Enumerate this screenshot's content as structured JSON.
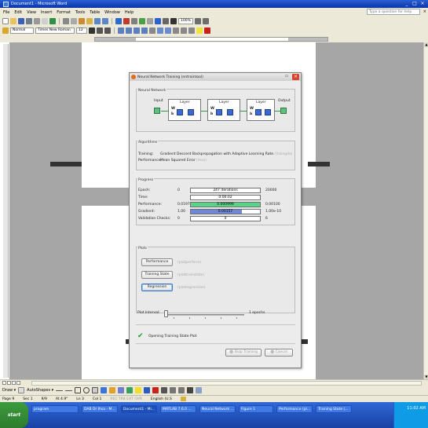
{
  "window": {
    "title": "Document1 - Microsoft Word",
    "controls": [
      "_",
      "□",
      "×"
    ]
  },
  "menu": {
    "items": [
      "File",
      "Edit",
      "View",
      "Insert",
      "Format",
      "Tools",
      "Table",
      "Window",
      "Help"
    ],
    "help_placeholder": "Type a question for help"
  },
  "formatting": {
    "style": "Normal",
    "font": "Times New Roman",
    "size": "12",
    "zoom": "100%"
  },
  "nn_dialog": {
    "title": "Neural Network Training (nntraintool)",
    "network_section": "Neural Network",
    "network": {
      "input_label": "Input",
      "layer_label": "Layer",
      "output_label": "Output",
      "w": "W",
      "b": "b"
    },
    "algorithms_section": "Algorithms",
    "training_label": "Training:",
    "training_value": "Gradient Descent Backpropagation with Adaptive Learning Rate.",
    "training_fn": "(traingdx)",
    "performance_label": "Performance:",
    "performance_value": "Mean Squared Error",
    "performance_fn": "(mse)",
    "progress_section": "Progress",
    "progress": [
      {
        "label": "Epoch:",
        "left": "0",
        "bar_text": "247 iterations",
        "right": "20000",
        "fill": 0,
        "color": ""
      },
      {
        "label": "Time:",
        "left": "",
        "bar_text": "0:00:02",
        "right": "",
        "fill": 0,
        "color": ""
      },
      {
        "label": "Performance:",
        "left": "0.0197",
        "bar_text": "0.000999",
        "right": "0.00100",
        "fill": 1.0,
        "color": "#59d487"
      },
      {
        "label": "Gradient:",
        "left": "1.00",
        "bar_text": "0.00157",
        "right": "1.00e-10",
        "fill": 0.74,
        "color": "#6f86d9"
      },
      {
        "label": "Validation Checks:",
        "left": "0",
        "bar_text": "0",
        "right": "6",
        "fill": 0,
        "color": ""
      }
    ],
    "plots_section": "Plots",
    "plots": [
      {
        "button": "Performance",
        "fn": "(plotperform)"
      },
      {
        "button": "Training State",
        "fn": "(plottrainstate)"
      },
      {
        "button": "Regression",
        "fn": "(plotregression)"
      }
    ],
    "plot_interval_label": "Plot Interval:",
    "plot_interval_value": "1 epochs",
    "status_text": "Opening Training State Plot",
    "stop_button": "Stop Training",
    "cancel_button": "Cancel"
  },
  "drawbar": {
    "draw": "Draw ▾",
    "autoshapes": "AutoShapes ▾"
  },
  "status": {
    "page": "Page 9",
    "sec": "Sec 1",
    "pos": "9/9",
    "at": "At 4.9\"",
    "ln": "Ln 3",
    "col": "Col 1",
    "modes": "REC  TRK  EXT  OVR",
    "lang": "English (U.S"
  },
  "taskbar": {
    "start": "start",
    "tasks": [
      "program",
      "DAB Dr Ihsa - M...",
      "Document1 - Mi...",
      "MATLAB 7.6.0 ...",
      "Neural Network ...",
      "Figure 1",
      "Performance (pl...",
      "Training State (..."
    ],
    "clock": "11:02 AM"
  }
}
